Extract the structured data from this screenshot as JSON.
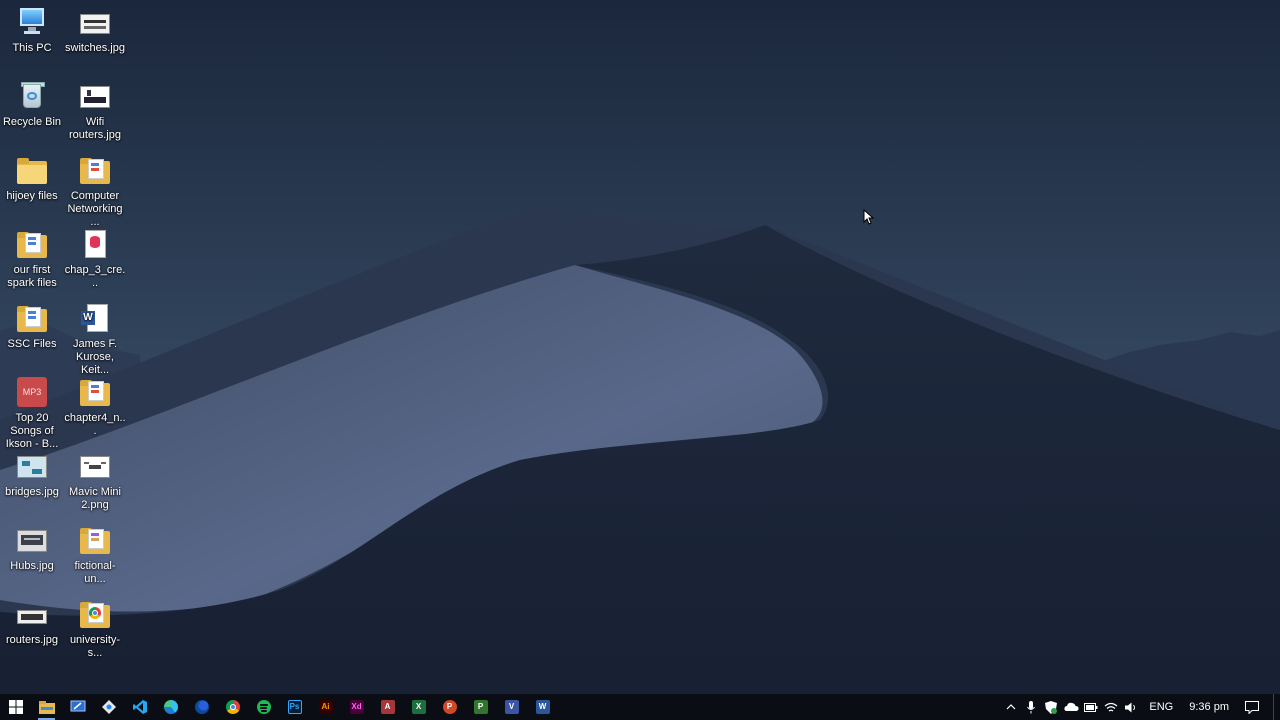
{
  "desktop_icons": [
    {
      "id": "this-pc",
      "label": "This PC"
    },
    {
      "id": "switches",
      "label": "switches.jpg"
    },
    {
      "id": "recycle-bin",
      "label": "Recycle Bin"
    },
    {
      "id": "wifi-routers",
      "label": "Wifi routers.jpg"
    },
    {
      "id": "hijoey-files",
      "label": "hijoey files"
    },
    {
      "id": "computer-networking",
      "label": "Computer Networking ..."
    },
    {
      "id": "our-first-spark",
      "label": "our first spark files"
    },
    {
      "id": "chap3",
      "label": "chap_3_cre..."
    },
    {
      "id": "ssc-files",
      "label": "SSC Files"
    },
    {
      "id": "james-kurose",
      "label": "James F. Kurose, Keit..."
    },
    {
      "id": "top20songs",
      "label": "Top 20 Songs of Ikson - B..."
    },
    {
      "id": "chapter4",
      "label": "chapter4_n..."
    },
    {
      "id": "bridges",
      "label": "bridges.jpg"
    },
    {
      "id": "mavic-mini",
      "label": "Mavic Mini 2.png"
    },
    {
      "id": "hubs",
      "label": "Hubs.jpg"
    },
    {
      "id": "fictional-un",
      "label": "fictional-un..."
    },
    {
      "id": "routers",
      "label": "routers.jpg"
    },
    {
      "id": "university-s",
      "label": "university-s..."
    }
  ],
  "mp3_badge": "MP3",
  "word_badge": "W",
  "taskbar": {
    "apps": [
      {
        "name": "file-explorer",
        "active": true
      },
      {
        "name": "remote-desktop"
      },
      {
        "name": "sourcetree"
      },
      {
        "name": "visual-studio-code"
      },
      {
        "name": "microsoft-edge"
      },
      {
        "name": "firefox"
      },
      {
        "name": "google-chrome"
      },
      {
        "name": "spotify"
      },
      {
        "name": "photoshop",
        "badge": "Ps"
      },
      {
        "name": "illustrator",
        "badge": "Ai"
      },
      {
        "name": "adobe-xd",
        "badge": "Xd"
      },
      {
        "name": "access",
        "badge": "A"
      },
      {
        "name": "excel",
        "badge": "X"
      },
      {
        "name": "powerpoint",
        "badge": "P"
      },
      {
        "name": "project",
        "badge": "P"
      },
      {
        "name": "visio",
        "badge": "V"
      },
      {
        "name": "word",
        "badge": "W"
      }
    ],
    "language": "ENG",
    "time": "9:36 pm"
  },
  "colors": {
    "sky_top": "#1c2a40",
    "sky_bottom": "#3a4f6e",
    "dune_light": "#5a6a86",
    "dune_dark": "#1d2538",
    "taskbar": "#0a0d14",
    "accent": "#7aa7e0"
  }
}
